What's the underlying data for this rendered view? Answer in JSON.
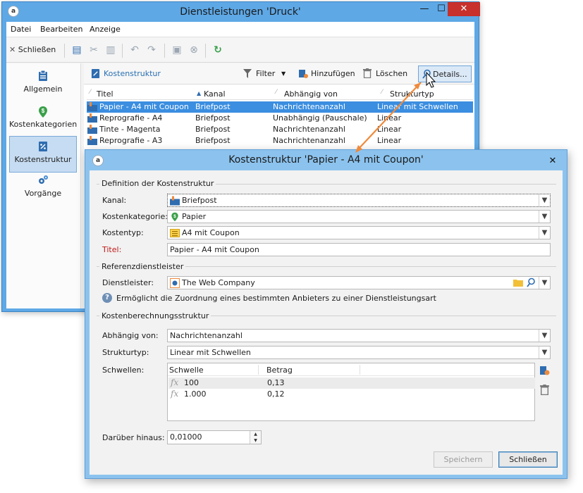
{
  "colors": {
    "accent": "#3b8ee0",
    "title_active": "#5ea8e6",
    "dialog_title": "#8cc3ee",
    "close_button": "#c7302b",
    "arrow": "#ef8a3c",
    "required_label": "#c01818"
  },
  "main_window": {
    "title": "Dienstleistungen 'Druck'",
    "caption_buttons": {
      "minimize": "—",
      "maximize": "☐",
      "close": "✕"
    },
    "menu": [
      "Datei",
      "Bearbeiten",
      "Anzeige"
    ],
    "toolbar": {
      "close_label": "Schließen",
      "close_icon": "✕"
    },
    "nav": [
      {
        "label": "Allgemein",
        "icon": "clipboard-icon"
      },
      {
        "label": "Kostenkategorien",
        "icon": "money-pin-icon"
      },
      {
        "label": "Kostenstruktur",
        "icon": "cost-structure-icon",
        "active": true
      },
      {
        "label": "Vorgänge",
        "icon": "gears-icon"
      }
    ],
    "list_toolbar": {
      "title": "Kostenstruktur",
      "filter": "Filter",
      "add": "Hinzufügen",
      "delete": "Löschen",
      "details": "Details..."
    },
    "columns": [
      "Titel",
      "Kanal",
      "Abhängig von",
      "Strukturtyp"
    ],
    "rows": [
      {
        "title": "Papier - A4 mit Coupon",
        "channel": "Briefpost",
        "depends": "Nachrichtenanzahl",
        "type": "Linear mit Schwellen",
        "selected": true
      },
      {
        "title": "Reprografie - A4",
        "channel": "Briefpost",
        "depends": "Unabhängig (Pauschale)",
        "type": "Linear"
      },
      {
        "title": "Tinte - Magenta",
        "channel": "Briefpost",
        "depends": "Nachrichtenanzahl",
        "type": "Linear"
      },
      {
        "title": "Reprografie - A3",
        "channel": "Briefpost",
        "depends": "Nachrichtenanzahl",
        "type": "Linear"
      }
    ]
  },
  "dialog": {
    "title": "Kostenstruktur 'Papier - A4 mit Coupon'",
    "close": "✕",
    "section_definition": "Definition der Kostenstruktur",
    "labels": {
      "channel": "Kanal:",
      "category": "Kostenkategorie:",
      "cost_type": "Kostentyp:",
      "title": "Titel:"
    },
    "values": {
      "channel": "Briefpost",
      "category": "Papier",
      "cost_type": "A4 mit Coupon",
      "title": "Papier - A4 mit Coupon"
    },
    "section_provider": "Referenzdienstleister",
    "provider_label": "Dienstleister:",
    "provider_value": "The Web Company",
    "provider_help": "Ermöglicht die Zuordnung eines bestimmten Anbieters zu einer Dienstleistungsart",
    "section_calc": "Kostenberechnungsstruktur",
    "depends_label": "Abhängig von:",
    "depends_value": "Nachrichtenanzahl",
    "structure_label": "Strukturtyp:",
    "structure_value": "Linear mit Schwellen",
    "thresholds_label": "Schwellen:",
    "thresholds_columns": [
      "Schwelle",
      "Betrag"
    ],
    "thresholds": [
      {
        "fx": "fx",
        "threshold": "100",
        "amount": "0,13"
      },
      {
        "fx": "fx",
        "threshold": "1.000",
        "amount": "0,12"
      }
    ],
    "above_label": "Darüber hinaus:",
    "above_value": "0,01000",
    "buttons": {
      "save": "Speichern",
      "close": "Schließen"
    }
  }
}
